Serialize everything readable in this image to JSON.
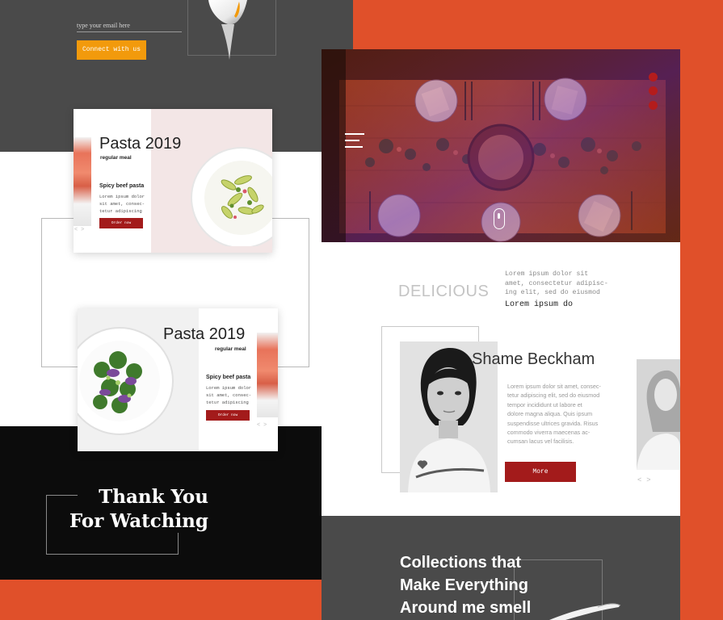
{
  "newsletter": {
    "email_placeholder": "type your email here",
    "connect_label": "Connect with us"
  },
  "cards": [
    {
      "title": "Pasta 2019",
      "subtitle": "regular meal",
      "dish": "Spicy beef pasta",
      "description": "Lorem ipsum dolor\nsit amet, consec-\ntetur adipiscing",
      "order_label": "Order now",
      "prev_icon": "<",
      "next_icon": ">"
    },
    {
      "title": "Pasta 2019",
      "subtitle": "regular meal",
      "dish": "Spicy beef pasta",
      "description": "Lorem ipsum dolor\nsit amet, consec-\ntetur adipiscing",
      "order_label": "Order now",
      "prev_icon": "<",
      "next_icon": ">"
    }
  ],
  "thanks": {
    "text": "Thank You\nFor Watching"
  },
  "hero": {
    "menu_icon": "hamburger-icon",
    "scroll_icon": "mouse-icon",
    "social_icons": [
      "social-icon",
      "social-icon",
      "social-icon"
    ]
  },
  "intro": {
    "heading": "DELICIOUS",
    "lorem": "Lorem ipsum dolor sit\namet, consectetur adipisc-\ning elit, sed do eiusmod",
    "highlight": "Lorem ipsum do"
  },
  "profile": {
    "name": "Shame Beckham",
    "bio": "Lorem ipsum dolor sit amet, consec-\ntetur adipiscing elit, sed do eiusmod\ntempor incididunt ut labore et\ndolore magna aliqua. Quis ipsum\nsuspendisse ultrices gravida. Risus\ncommodo viverra maecenas ac-\ncumsan lacus vel facilisis.",
    "more_label": "More",
    "prev_icon": "<",
    "next_icon": ">"
  },
  "collections": {
    "text": "Collections that\nMake Everything\nAround me smell"
  },
  "colors": {
    "accent_orange": "#e0502a",
    "button_red": "#a31b1b",
    "button_yellow": "#f29a0c",
    "dark_gray": "#4a4a4a"
  }
}
